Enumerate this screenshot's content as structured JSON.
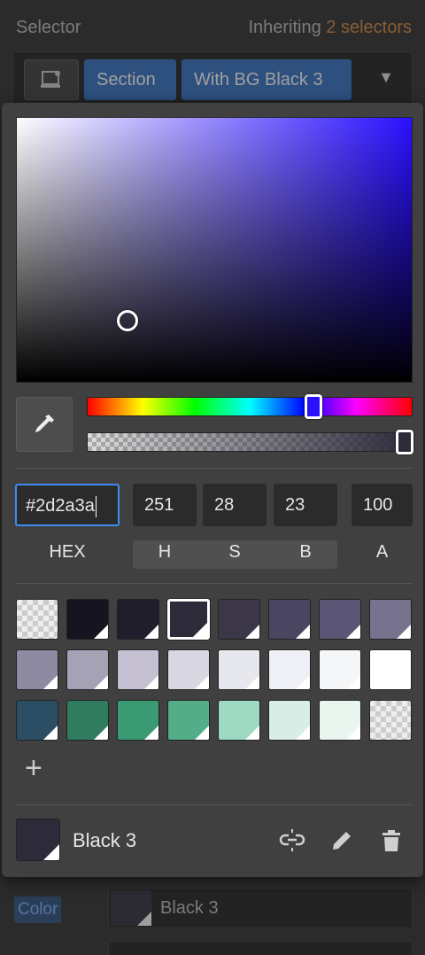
{
  "selector": {
    "label": "Selector",
    "inheriting_prefix": "Inheriting",
    "inheriting_count": "2 selectors",
    "chips": [
      "Section",
      "With BG Black 3"
    ]
  },
  "picker": {
    "hue_color": "#2a10ff",
    "saturation_percent": 28,
    "brightness_percent": 23,
    "hue_degrees": 251,
    "alpha_percent": 100,
    "hex_value": "#2d2a3a",
    "h_value": "251",
    "s_value": "28",
    "b_value": "23",
    "a_value": "100",
    "labels": {
      "hex": "HEX",
      "h": "H",
      "s": "S",
      "b": "B",
      "a": "A"
    }
  },
  "swatches": [
    [
      "transparent",
      "#16151f",
      "#211e2c",
      "#2d2a3a",
      "#3b3749",
      "#4a4560",
      "#5b5676",
      "#77728d"
    ],
    [
      "#8e8aa2",
      "#a6a2b6",
      "#c4c0d1",
      "#d8d6e1",
      "#e7e7ee",
      "#eef0f5",
      "#f5f6f8",
      "#ffffff"
    ],
    [
      "#2b4e64",
      "#2f7c5e",
      "#3a9a73",
      "#53ad88",
      "#9ed9c2",
      "#d7ede5",
      "#e9f6f0",
      "transparent"
    ]
  ],
  "selected_swatch": "#2d2a3a",
  "current_color": {
    "name": "Black 3",
    "color": "#2d2a3a"
  },
  "property": {
    "label": "Color",
    "value_name": "Black 3"
  }
}
